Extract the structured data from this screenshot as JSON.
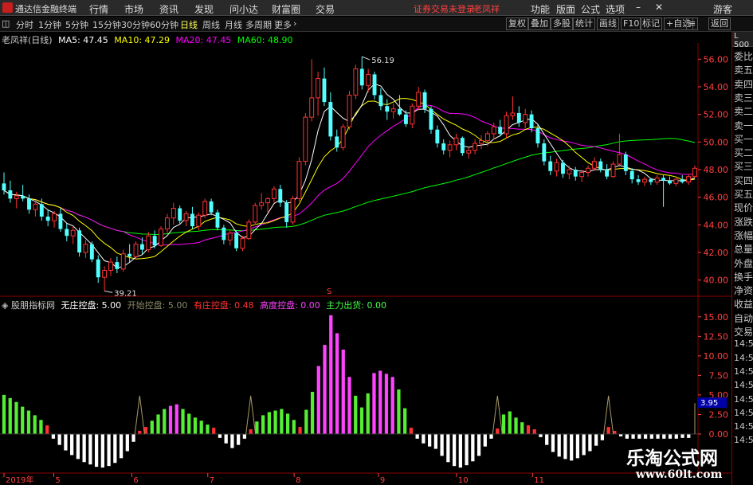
{
  "app_title": "通达信金融终端",
  "menu": [
    "行情",
    "市场",
    "资讯",
    "发现",
    "问小达",
    "财富圈",
    "交易"
  ],
  "login_warning": "证券交易未登录",
  "stock_name_top": "老凤祥",
  "menu_right": [
    "功能",
    "版面",
    "公式",
    "选项"
  ],
  "guest": "游客",
  "periods": [
    "分时",
    "1分钟",
    "5分钟",
    "15分钟",
    "30分钟",
    "60分钟",
    "日线",
    "周线",
    "月线",
    "多周期",
    "更多"
  ],
  "active_period": "日线",
  "right_tools": [
    "复权",
    "叠加",
    "多股",
    "统计",
    "画线",
    "F10",
    "标记",
    "+自选",
    "返回"
  ],
  "main_chart": {
    "title": "老凤祥(日线)",
    "ma5": "MA5: 47.45",
    "ma10": "MA10: 47.29",
    "ma20": "MA20: 47.45",
    "ma60": "MA60: 48.90",
    "high_label": "56.19",
    "low_label": "39.21",
    "y_ticks": [
      "56.00",
      "54.00",
      "52.00",
      "50.00",
      "48.00",
      "46.00",
      "44.00",
      "42.00",
      "40.00"
    ],
    "colors": {
      "up": "#ff3232",
      "down": "#54ffff",
      "ma5": "#ffffff",
      "ma10": "#ffff00",
      "ma20": "#ff00ff",
      "ma60": "#00ff00"
    }
  },
  "sub_chart": {
    "title": "股朋指标网",
    "v1": "无庄控盘: 5.00",
    "v2": "开始控盘: 5.00",
    "v3": "有庄控盘: 0.48",
    "v4": "高度控盘: 0.00",
    "v5": "主力出货: 0.00",
    "y_ticks": [
      "15.00",
      "12.50",
      "10.00",
      "7.50",
      "5.00",
      "2.50",
      "0.00"
    ],
    "current_value": "3.95"
  },
  "x_axis": [
    "2019年",
    "5",
    "6",
    "7",
    "8",
    "9",
    "10",
    "11"
  ],
  "side_panel": [
    "委比",
    "卖五",
    "卖四",
    "卖三",
    "卖二",
    "卖一",
    "买一",
    "买二",
    "买三",
    "买四",
    "买五",
    "现价",
    "涨跌",
    "涨幅",
    "总量",
    "外盘",
    "换手",
    "净资",
    "收益",
    "自动",
    "交易",
    "14:56",
    "14:56",
    "14:56",
    "14:56",
    "14:56",
    "14:56",
    "14:56",
    "14:56"
  ],
  "side_top": "L 500",
  "watermark_cn": "乐淘公式网",
  "watermark_url": "www.60lt.com",
  "chart_data": {
    "type": "candlestick",
    "title": "老凤祥(日线)",
    "ylim": [
      39.0,
      57.0
    ],
    "x_labels": [
      "2019年",
      "5",
      "6",
      "7",
      "8",
      "9",
      "10",
      "11"
    ],
    "ohlc": [
      [
        47.0,
        47.8,
        46.2,
        46.5
      ],
      [
        46.5,
        47.2,
        45.6,
        45.9
      ],
      [
        45.9,
        46.4,
        45.2,
        46.1
      ],
      [
        46.1,
        46.9,
        45.7,
        45.9
      ],
      [
        45.9,
        46.2,
        44.8,
        45.1
      ],
      [
        45.1,
        45.8,
        44.6,
        45.5
      ],
      [
        45.5,
        45.9,
        44.3,
        44.6
      ],
      [
        44.6,
        45.1,
        43.9,
        44.3
      ],
      [
        44.3,
        45.0,
        43.8,
        44.8
      ],
      [
        44.8,
        45.2,
        43.5,
        43.7
      ],
      [
        43.7,
        44.1,
        42.8,
        43.2
      ],
      [
        43.2,
        43.9,
        42.6,
        43.6
      ],
      [
        43.6,
        43.8,
        41.7,
        42.0
      ],
      [
        42.0,
        42.9,
        41.6,
        42.6
      ],
      [
        42.6,
        42.8,
        41.3,
        41.5
      ],
      [
        41.5,
        41.8,
        39.8,
        40.2
      ],
      [
        40.2,
        41.0,
        39.21,
        40.7
      ],
      [
        40.7,
        41.6,
        40.3,
        41.3
      ],
      [
        41.3,
        41.7,
        40.5,
        40.8
      ],
      [
        40.8,
        42.2,
        40.6,
        41.9
      ],
      [
        41.9,
        42.6,
        41.3,
        41.7
      ],
      [
        41.7,
        42.8,
        41.5,
        42.6
      ],
      [
        42.6,
        43.1,
        41.9,
        42.2
      ],
      [
        42.2,
        43.5,
        42.0,
        43.2
      ],
      [
        43.2,
        43.6,
        42.3,
        42.5
      ],
      [
        42.5,
        43.9,
        42.4,
        43.7
      ],
      [
        43.7,
        44.8,
        43.4,
        44.5
      ],
      [
        44.5,
        45.6,
        44.0,
        45.2
      ],
      [
        45.2,
        45.4,
        44.1,
        44.3
      ],
      [
        44.3,
        45.0,
        43.9,
        44.8
      ],
      [
        44.8,
        45.3,
        43.7,
        43.9
      ],
      [
        43.9,
        44.9,
        43.6,
        44.7
      ],
      [
        44.7,
        45.9,
        44.5,
        45.7
      ],
      [
        45.7,
        45.9,
        44.7,
        44.9
      ],
      [
        44.9,
        45.1,
        43.6,
        43.8
      ],
      [
        43.8,
        44.0,
        42.6,
        42.9
      ],
      [
        42.9,
        43.6,
        42.5,
        43.4
      ],
      [
        43.4,
        43.6,
        42.1,
        42.3
      ],
      [
        42.3,
        43.2,
        42.1,
        43.0
      ],
      [
        43.0,
        44.4,
        42.9,
        44.2
      ],
      [
        44.2,
        45.6,
        44.0,
        45.4
      ],
      [
        45.4,
        46.3,
        45.1,
        45.6
      ],
      [
        45.6,
        46.0,
        44.9,
        45.9
      ],
      [
        45.9,
        46.8,
        45.6,
        46.6
      ],
      [
        46.6,
        46.9,
        45.3,
        45.6
      ],
      [
        45.6,
        45.8,
        43.8,
        44.2
      ],
      [
        44.2,
        46.1,
        44.0,
        45.9
      ],
      [
        45.9,
        48.9,
        45.7,
        48.6
      ],
      [
        48.6,
        52.1,
        48.3,
        51.8
      ],
      [
        51.8,
        56.0,
        51.5,
        53.2
      ],
      [
        53.2,
        55.1,
        51.9,
        54.6
      ],
      [
        54.6,
        55.4,
        52.6,
        52.9
      ],
      [
        52.9,
        53.6,
        50.1,
        50.4
      ],
      [
        50.4,
        50.9,
        49.3,
        49.6
      ],
      [
        49.6,
        51.3,
        49.4,
        51.1
      ],
      [
        51.1,
        53.7,
        50.9,
        53.4
      ],
      [
        53.4,
        55.6,
        53.1,
        55.3
      ],
      [
        55.3,
        56.19,
        53.8,
        54.1
      ],
      [
        54.1,
        55.3,
        53.6,
        54.9
      ],
      [
        54.9,
        55.1,
        53.1,
        53.4
      ],
      [
        53.4,
        53.9,
        52.3,
        52.6
      ],
      [
        52.6,
        53.1,
        51.6,
        52.2
      ],
      [
        52.2,
        52.8,
        51.7,
        52.4
      ],
      [
        52.4,
        53.4,
        51.9,
        52.0
      ],
      [
        52.0,
        52.3,
        51.1,
        51.3
      ],
      [
        51.3,
        52.8,
        51.0,
        52.6
      ],
      [
        52.6,
        54.0,
        52.3,
        53.6
      ],
      [
        53.6,
        53.8,
        52.1,
        52.4
      ],
      [
        52.4,
        52.6,
        50.6,
        50.9
      ],
      [
        50.9,
        51.2,
        49.6,
        49.9
      ],
      [
        49.9,
        50.2,
        49.1,
        49.4
      ],
      [
        49.4,
        50.1,
        48.9,
        49.8
      ],
      [
        49.8,
        50.6,
        49.4,
        50.3
      ],
      [
        50.3,
        50.4,
        49.0,
        49.2
      ],
      [
        49.2,
        49.6,
        48.8,
        49.4
      ],
      [
        49.4,
        50.2,
        49.1,
        49.9
      ],
      [
        49.9,
        50.5,
        49.5,
        50.1
      ],
      [
        50.1,
        50.8,
        49.7,
        50.6
      ],
      [
        50.6,
        51.4,
        50.2,
        51.1
      ],
      [
        51.1,
        51.6,
        50.4,
        50.6
      ],
      [
        50.6,
        52.2,
        50.3,
        51.9
      ],
      [
        51.9,
        53.3,
        51.6,
        52.1
      ],
      [
        52.1,
        52.6,
        51.1,
        51.4
      ],
      [
        51.4,
        52.4,
        51.0,
        52.0
      ],
      [
        52.0,
        52.3,
        50.7,
        51.0
      ],
      [
        51.0,
        51.3,
        49.6,
        49.9
      ],
      [
        49.9,
        50.2,
        48.3,
        48.6
      ],
      [
        48.6,
        49.0,
        47.6,
        47.9
      ],
      [
        47.9,
        48.8,
        47.5,
        48.5
      ],
      [
        48.5,
        48.7,
        47.4,
        47.7
      ],
      [
        47.7,
        48.3,
        47.3,
        48.0
      ],
      [
        48.0,
        48.2,
        47.2,
        47.5
      ],
      [
        47.5,
        48.0,
        47.1,
        47.8
      ],
      [
        47.8,
        48.3,
        47.5,
        48.1
      ],
      [
        48.1,
        48.9,
        47.9,
        48.6
      ],
      [
        48.6,
        48.8,
        47.8,
        48.0
      ],
      [
        48.0,
        48.4,
        47.3,
        47.5
      ],
      [
        47.5,
        48.6,
        47.4,
        48.4
      ],
      [
        48.4,
        50.6,
        48.2,
        49.1
      ],
      [
        49.1,
        49.3,
        47.6,
        47.9
      ],
      [
        47.9,
        48.1,
        47.0,
        47.3
      ],
      [
        47.3,
        47.6,
        46.9,
        47.1
      ],
      [
        47.1,
        47.5,
        46.8,
        47.3
      ],
      [
        47.3,
        47.4,
        46.9,
        47.1
      ],
      [
        47.1,
        47.6,
        46.9,
        47.4
      ],
      [
        47.4,
        47.6,
        45.3,
        47.2
      ],
      [
        47.2,
        47.5,
        46.9,
        47.0
      ],
      [
        47.0,
        47.4,
        46.8,
        47.3
      ],
      [
        47.3,
        47.6,
        47.0,
        47.1
      ],
      [
        47.1,
        47.7,
        46.9,
        47.5
      ],
      [
        47.5,
        48.3,
        47.4,
        48.1
      ]
    ],
    "ma": {
      "MA5": 47.45,
      "MA10": 47.29,
      "MA20": 47.45,
      "MA60": 48.9
    },
    "indicator": {
      "name": "股朋指标网",
      "ylim": [
        -5.0,
        16.0
      ],
      "values": [
        5.0,
        4.6,
        4.1,
        3.5,
        3.0,
        2.4,
        1.8,
        1.1,
        -0.6,
        -1.4,
        -2.1,
        -2.7,
        -3.2,
        -3.6,
        -3.9,
        -4.2,
        -4.3,
        -4.1,
        -3.7,
        -3.1,
        -2.2,
        -1.0,
        0.4,
        0.9,
        1.7,
        2.5,
        3.2,
        3.6,
        3.8,
        3.2,
        2.6,
        2.1,
        1.7,
        1.2,
        0.8,
        -0.5,
        -1.2,
        -1.8,
        -1.4,
        -0.6,
        0.6,
        1.6,
        2.4,
        2.8,
        3.0,
        3.2,
        2.6,
        1.8,
        0.9,
        3.1,
        5.4,
        8.7,
        11.4,
        15.2,
        12.9,
        10.8,
        7.3,
        4.9,
        3.4,
        5.2,
        7.8,
        8.1,
        7.7,
        7.3,
        5.7,
        3.3,
        0.8,
        -0.6,
        -1.2,
        -1.6,
        -1.9,
        -2.8,
        -3.6,
        -4.1,
        -4.3,
        -4.0,
        -3.5,
        -2.8,
        -1.6,
        -0.6,
        0.7,
        2.5,
        2.9,
        2.1,
        1.5,
        1.1,
        0.6,
        -0.4,
        -1.4,
        -2.3,
        -2.9,
        -3.2,
        -3.4,
        -3.1,
        -2.7,
        -2.2,
        -1.5,
        -0.8,
        0.9,
        0.4,
        -0.3,
        -0.6,
        -0.6,
        -0.6,
        -0.6,
        -0.6,
        -0.6,
        -0.6,
        -0.6,
        -0.6,
        -0.5,
        -0.5,
        3.95
      ]
    }
  }
}
